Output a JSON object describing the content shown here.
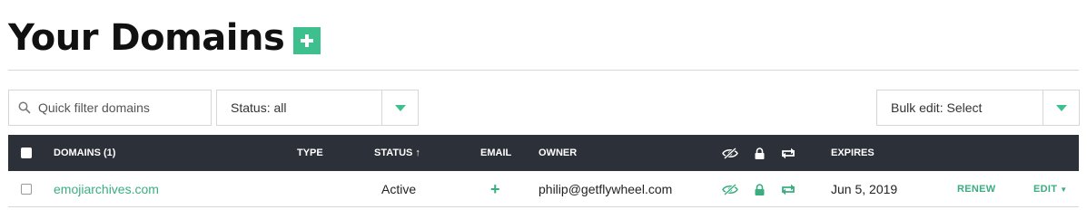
{
  "page": {
    "title": "Your Domains"
  },
  "filters": {
    "quick_filter_placeholder": "Quick filter domains",
    "status_select_value": "Status: all",
    "bulk_edit_value": "Bulk edit: Select"
  },
  "table": {
    "headers": {
      "domains": "DOMAINS (1)",
      "type": "TYPE",
      "status": "STATUS ↑",
      "email": "EMAIL",
      "owner": "OWNER",
      "privacy_icon": "eye-slash-icon",
      "lock_icon": "lock-icon",
      "autorenew_icon": "autorenew-icon",
      "expires": "EXPIRES"
    },
    "rows": [
      {
        "domain": "emojiarchives.com",
        "type": "",
        "status": "Active",
        "email": "+",
        "owner": "philip@getflywheel.com",
        "expires": "Jun 5, 2019",
        "renew": "RENEW",
        "edit": "EDIT"
      }
    ]
  },
  "colors": {
    "accent": "#3dbf8e",
    "header_bg": "#2b3039",
    "link": "#3aae7f"
  }
}
